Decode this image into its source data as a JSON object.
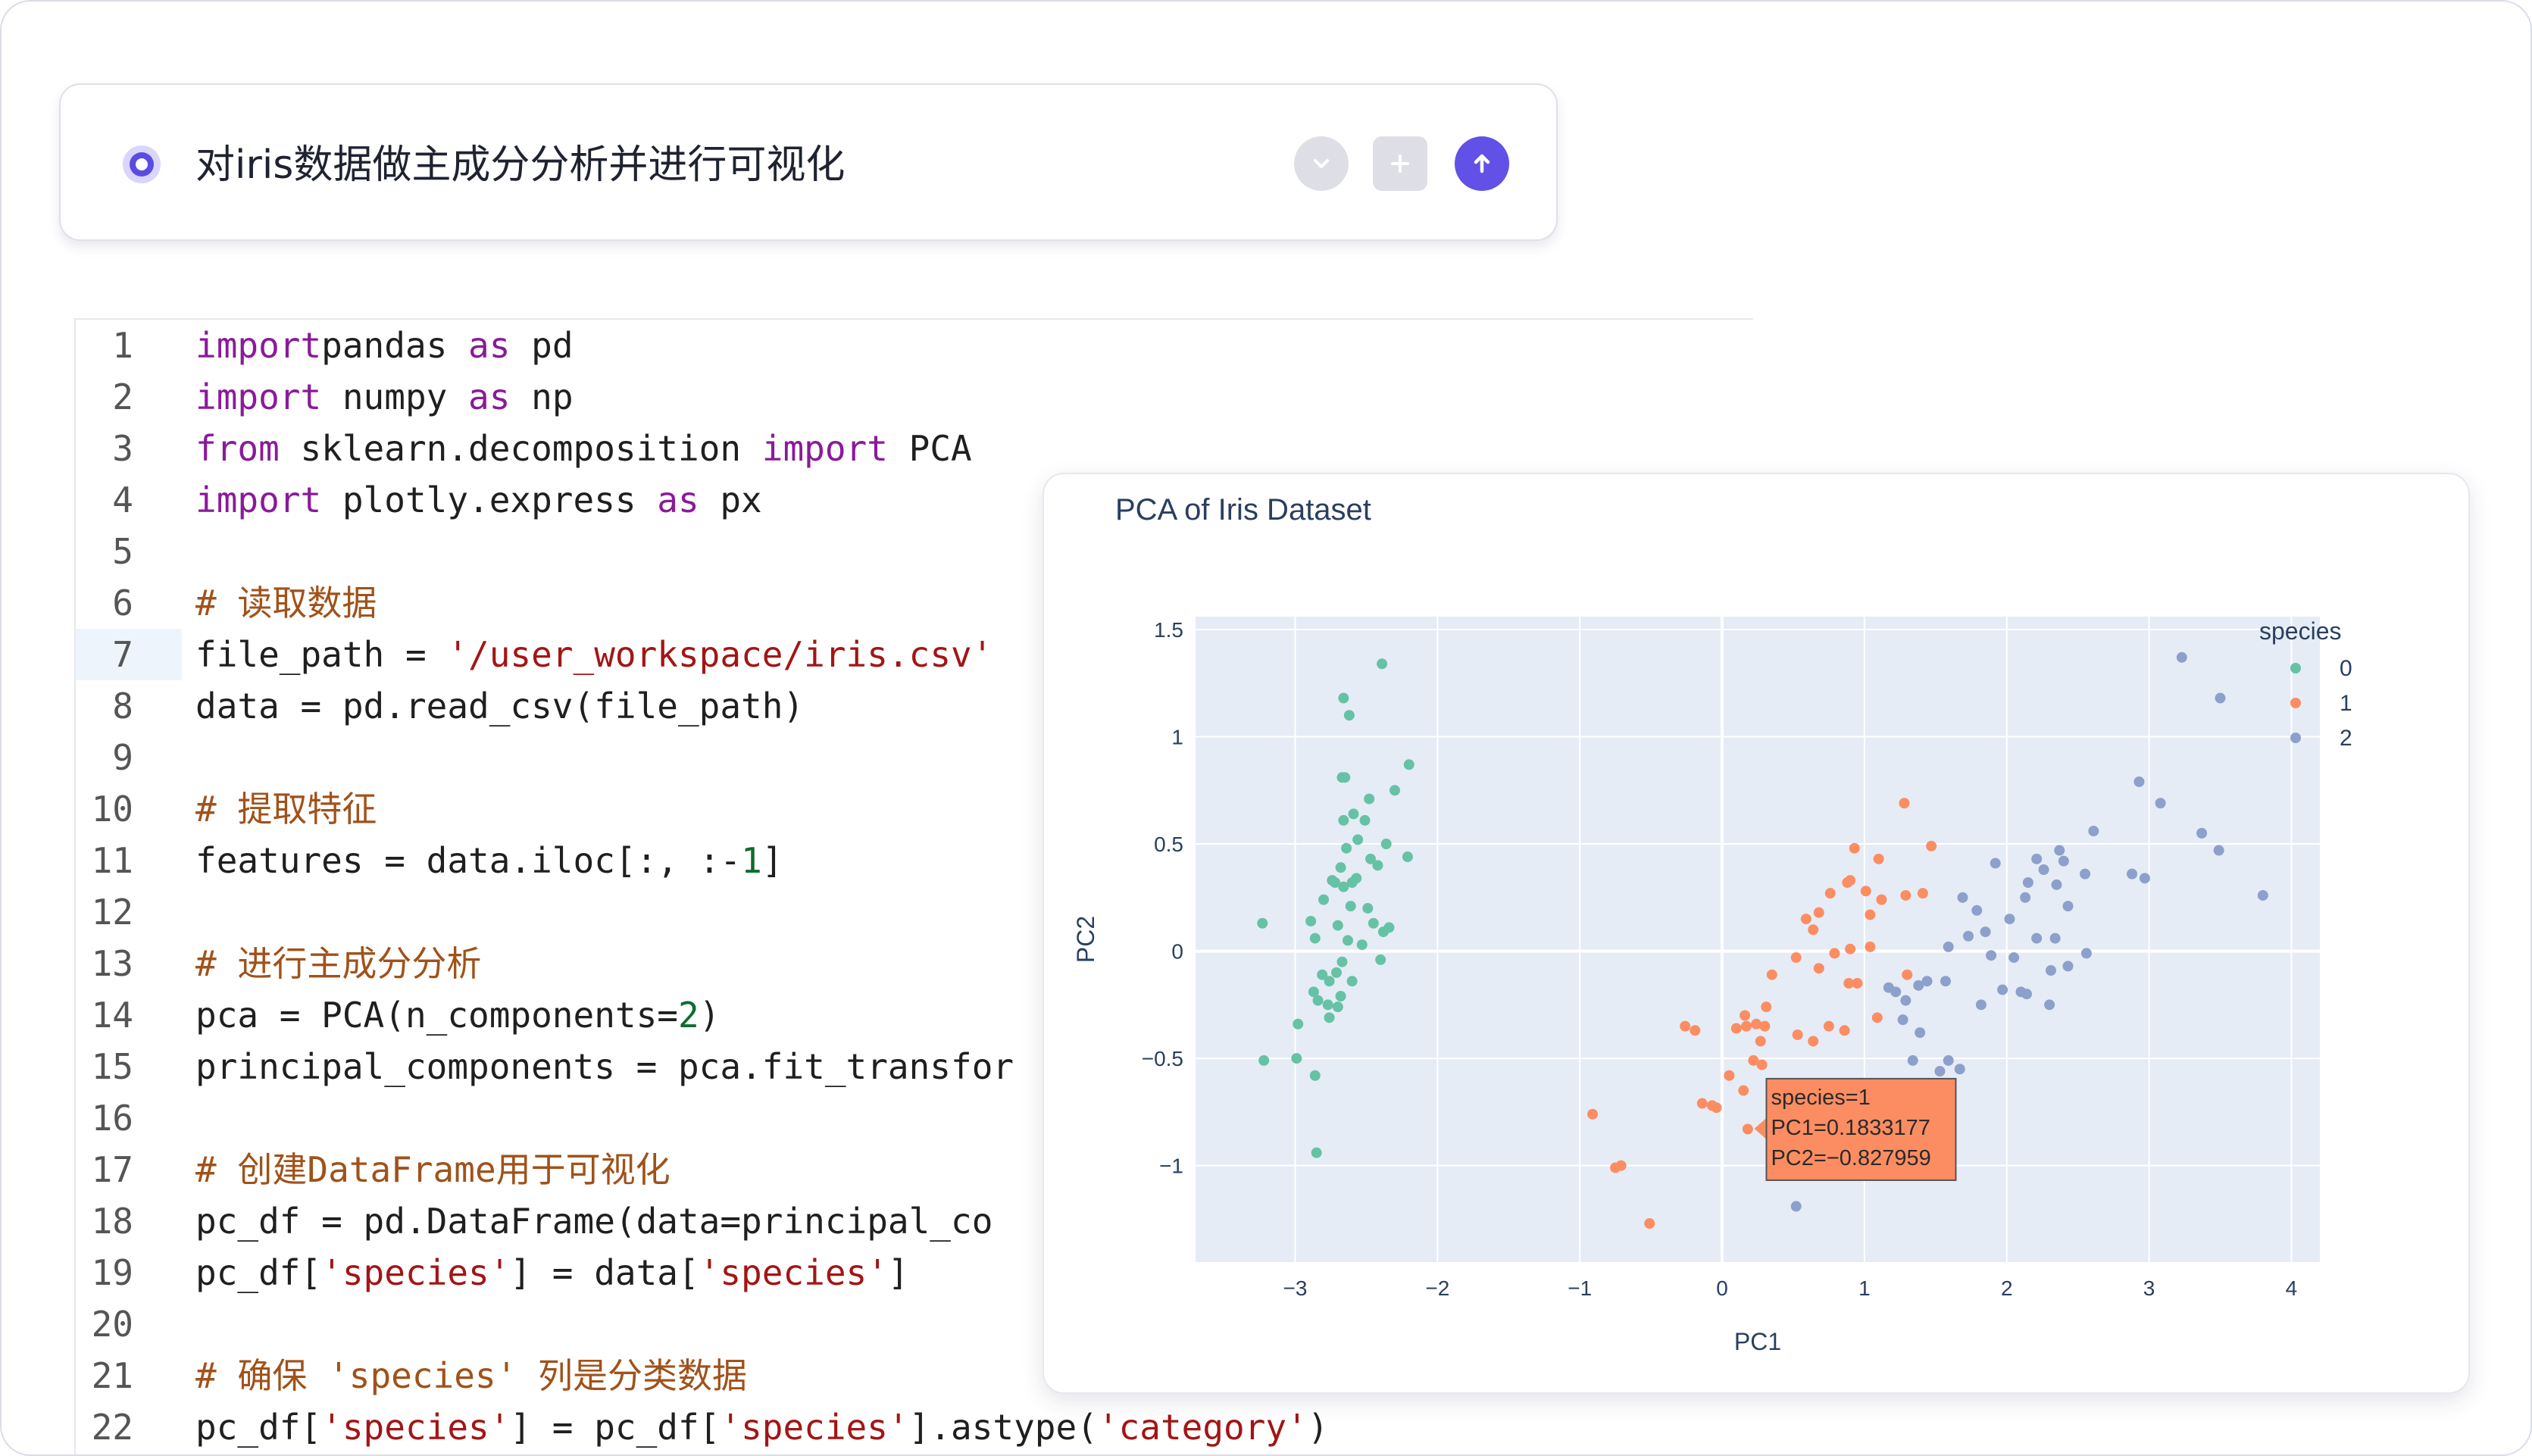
{
  "prompt": {
    "text": "对iris数据做主成分分析并进行可视化",
    "collapse_icon": "chevron-down-icon",
    "attach_icon": "plus-icon",
    "send_icon": "arrow-up-icon",
    "accent_color": "#6151e6"
  },
  "editor": {
    "active_line": 7,
    "lines": [
      {
        "n": "1",
        "segments": [
          [
            "kw",
            "import"
          ],
          [
            "",
            "pandas "
          ],
          [
            "kw",
            "as"
          ],
          [
            "",
            " pd"
          ]
        ]
      },
      {
        "n": "2",
        "segments": [
          [
            "kw",
            "import"
          ],
          [
            "",
            " numpy "
          ],
          [
            "kw",
            "as"
          ],
          [
            "",
            " np"
          ]
        ]
      },
      {
        "n": "3",
        "segments": [
          [
            "kw",
            "from"
          ],
          [
            "",
            " sklearn.decomposition "
          ],
          [
            "kw",
            "import"
          ],
          [
            "",
            " PCA"
          ]
        ]
      },
      {
        "n": "4",
        "segments": [
          [
            "kw",
            "import"
          ],
          [
            "",
            " plotly.express "
          ],
          [
            "kw",
            "as"
          ],
          [
            "",
            " px"
          ]
        ]
      },
      {
        "n": "5",
        "segments": []
      },
      {
        "n": "6",
        "segments": [
          [
            "cm",
            "# 读取数据"
          ]
        ]
      },
      {
        "n": "7",
        "segments": [
          [
            "",
            "file_path = "
          ],
          [
            "str",
            "'/user_workspace/iris.csv'"
          ]
        ]
      },
      {
        "n": "8",
        "segments": [
          [
            "",
            "data = pd.read_csv(file_path)"
          ]
        ]
      },
      {
        "n": "9",
        "segments": []
      },
      {
        "n": "10",
        "segments": [
          [
            "cm",
            "# 提取特征"
          ]
        ]
      },
      {
        "n": "11",
        "segments": [
          [
            "",
            "features = data.iloc[:, :-"
          ],
          [
            "num",
            "1"
          ],
          [
            "",
            "]"
          ]
        ]
      },
      {
        "n": "12",
        "segments": []
      },
      {
        "n": "13",
        "segments": [
          [
            "cm",
            "# 进行主成分分析"
          ]
        ]
      },
      {
        "n": "14",
        "segments": [
          [
            "",
            "pca = PCA(n_components="
          ],
          [
            "num",
            "2"
          ],
          [
            "",
            ")"
          ]
        ]
      },
      {
        "n": "15",
        "segments": [
          [
            "",
            "principal_components = pca.fit_transfor"
          ]
        ]
      },
      {
        "n": "16",
        "segments": []
      },
      {
        "n": "17",
        "segments": [
          [
            "cm",
            "# 创建DataFrame用于可视化"
          ]
        ]
      },
      {
        "n": "18",
        "segments": [
          [
            "",
            "pc_df = pd.DataFrame(data=principal_co"
          ]
        ]
      },
      {
        "n": "19",
        "segments": [
          [
            "",
            "pc_df["
          ],
          [
            "str",
            "'species'"
          ],
          [
            "",
            "] = data["
          ],
          [
            "str",
            "'species'"
          ],
          [
            "",
            "]"
          ]
        ]
      },
      {
        "n": "20",
        "segments": []
      },
      {
        "n": "21",
        "segments": [
          [
            "cm",
            "# 确保 'species' 列是分类数据"
          ]
        ]
      },
      {
        "n": "22",
        "segments": [
          [
            "",
            "pc_df["
          ],
          [
            "str",
            "'species'"
          ],
          [
            "",
            "] = pc_df["
          ],
          [
            "str",
            "'species'"
          ],
          [
            "",
            "].astype("
          ],
          [
            "str",
            "'category'"
          ],
          [
            "",
            ")"
          ]
        ]
      }
    ]
  },
  "chart_data": {
    "type": "scatter",
    "title": "PCA of Iris Dataset",
    "xlabel": "PC1",
    "ylabel": "PC2",
    "xlim": [
      -3.7,
      4.2
    ],
    "ylim": [
      -1.45,
      1.56
    ],
    "xticks": [
      -3,
      -2,
      -1,
      0,
      1,
      2,
      3,
      4
    ],
    "xtick_labels": [
      "−3",
      "−2",
      "−1",
      "0",
      "1",
      "2",
      "3",
      "4"
    ],
    "yticks": [
      -1,
      -0.5,
      0,
      0.5,
      1,
      1.5
    ],
    "ytick_labels": [
      "−1",
      "−0.5",
      "0",
      "0.5",
      "1",
      "1.5"
    ],
    "grid": true,
    "legend_title": "species",
    "legend_position": "top-right",
    "plot_bg": "#e5ecf6",
    "series": [
      {
        "name": "0",
        "color": "#66c2a5",
        "points": [
          [
            -2.39,
            1.34
          ],
          [
            -2.66,
            1.18
          ],
          [
            -2.62,
            1.1
          ],
          [
            -2.2,
            0.87
          ],
          [
            -2.3,
            0.75
          ],
          [
            -2.48,
            0.71
          ],
          [
            -2.65,
            0.81
          ],
          [
            -2.67,
            0.81
          ],
          [
            -2.59,
            0.64
          ],
          [
            -2.66,
            0.61
          ],
          [
            -2.51,
            0.61
          ],
          [
            -2.36,
            0.5
          ],
          [
            -2.56,
            0.52
          ],
          [
            -2.64,
            0.48
          ],
          [
            -2.68,
            0.39
          ],
          [
            -2.47,
            0.43
          ],
          [
            -2.21,
            0.44
          ],
          [
            -2.42,
            0.4
          ],
          [
            -2.57,
            0.34
          ],
          [
            -2.72,
            0.32
          ],
          [
            -2.74,
            0.33
          ],
          [
            -2.6,
            0.32
          ],
          [
            -2.66,
            0.3
          ],
          [
            -2.61,
            0.21
          ],
          [
            -2.8,
            0.24
          ],
          [
            -2.49,
            0.2
          ],
          [
            -2.34,
            0.11
          ],
          [
            -2.45,
            0.13
          ],
          [
            -2.7,
            0.12
          ],
          [
            -2.89,
            0.14
          ],
          [
            -3.23,
            0.13
          ],
          [
            -2.38,
            0.09
          ],
          [
            -2.63,
            0.05
          ],
          [
            -2.86,
            0.06
          ],
          [
            -2.53,
            0.03
          ],
          [
            -2.67,
            -0.05
          ],
          [
            -2.4,
            -0.04
          ],
          [
            -2.71,
            -0.1
          ],
          [
            -2.81,
            -0.11
          ],
          [
            -2.6,
            -0.14
          ],
          [
            -2.76,
            -0.14
          ],
          [
            -2.87,
            -0.19
          ],
          [
            -2.68,
            -0.21
          ],
          [
            -2.84,
            -0.23
          ],
          [
            -2.77,
            -0.25
          ],
          [
            -2.7,
            -0.26
          ],
          [
            -2.76,
            -0.31
          ],
          [
            -2.98,
            -0.34
          ],
          [
            -3.22,
            -0.51
          ],
          [
            -2.99,
            -0.5
          ],
          [
            -2.86,
            -0.58
          ],
          [
            -2.85,
            -0.94
          ]
        ]
      },
      {
        "name": "1",
        "color": "#fc8d62",
        "points": [
          [
            1.28,
            0.69
          ],
          [
            1.47,
            0.49
          ],
          [
            0.93,
            0.48
          ],
          [
            1.1,
            0.43
          ],
          [
            0.9,
            0.33
          ],
          [
            0.88,
            0.32
          ],
          [
            1.01,
            0.28
          ],
          [
            1.41,
            0.27
          ],
          [
            1.29,
            0.26
          ],
          [
            0.76,
            0.27
          ],
          [
            1.12,
            0.24
          ],
          [
            0.68,
            0.18
          ],
          [
            0.59,
            0.15
          ],
          [
            1.04,
            0.17
          ],
          [
            0.64,
            0.1
          ],
          [
            0.52,
            -0.03
          ],
          [
            0.9,
            0.01
          ],
          [
            0.79,
            -0.01
          ],
          [
            1.04,
            0.02
          ],
          [
            0.35,
            -0.11
          ],
          [
            0.68,
            -0.08
          ],
          [
            1.3,
            -0.11
          ],
          [
            0.89,
            -0.15
          ],
          [
            0.95,
            -0.15
          ],
          [
            0.16,
            -0.3
          ],
          [
            0.31,
            -0.26
          ],
          [
            0.24,
            -0.34
          ],
          [
            0.53,
            -0.39
          ],
          [
            0.27,
            -0.42
          ],
          [
            0.17,
            -0.35
          ],
          [
            0.3,
            -0.35
          ],
          [
            0.1,
            -0.36
          ],
          [
            0.75,
            -0.35
          ],
          [
            -0.19,
            -0.37
          ],
          [
            0.64,
            -0.42
          ],
          [
            0.86,
            -0.37
          ],
          [
            0.22,
            -0.51
          ],
          [
            0.28,
            -0.53
          ],
          [
            1.09,
            -0.31
          ],
          [
            -0.26,
            -0.35
          ],
          [
            0.35,
            -0.66
          ],
          [
            0.05,
            -0.58
          ],
          [
            0.15,
            -0.65
          ],
          [
            -0.14,
            -0.71
          ],
          [
            -0.04,
            -0.73
          ],
          [
            -0.07,
            -0.72
          ],
          [
            0.18,
            -0.83
          ],
          [
            -0.91,
            -0.76
          ],
          [
            -0.75,
            -1.01
          ],
          [
            -0.71,
            -1.0
          ],
          [
            -0.51,
            -1.27
          ]
        ]
      },
      {
        "name": "2",
        "color": "#8da0cb",
        "points": [
          [
            3.23,
            1.37
          ],
          [
            3.5,
            1.18
          ],
          [
            2.93,
            0.79
          ],
          [
            3.08,
            0.69
          ],
          [
            3.37,
            0.55
          ],
          [
            3.49,
            0.47
          ],
          [
            2.61,
            0.56
          ],
          [
            2.37,
            0.47
          ],
          [
            2.88,
            0.36
          ],
          [
            2.97,
            0.34
          ],
          [
            3.8,
            0.26
          ],
          [
            2.21,
            0.43
          ],
          [
            2.4,
            0.42
          ],
          [
            1.92,
            0.41
          ],
          [
            2.15,
            0.32
          ],
          [
            2.26,
            0.38
          ],
          [
            2.35,
            0.31
          ],
          [
            2.55,
            0.36
          ],
          [
            2.43,
            0.21
          ],
          [
            2.13,
            0.25
          ],
          [
            1.69,
            0.25
          ],
          [
            1.79,
            0.19
          ],
          [
            2.02,
            0.15
          ],
          [
            1.85,
            0.09
          ],
          [
            2.21,
            0.06
          ],
          [
            2.34,
            0.06
          ],
          [
            1.89,
            -0.02
          ],
          [
            1.73,
            0.07
          ],
          [
            1.59,
            0.02
          ],
          [
            2.05,
            -0.03
          ],
          [
            2.56,
            -0.01
          ],
          [
            2.31,
            -0.09
          ],
          [
            2.43,
            -0.07
          ],
          [
            1.17,
            -0.17
          ],
          [
            1.22,
            -0.19
          ],
          [
            1.38,
            -0.16
          ],
          [
            1.29,
            -0.23
          ],
          [
            1.44,
            -0.14
          ],
          [
            1.57,
            -0.14
          ],
          [
            1.82,
            -0.25
          ],
          [
            1.97,
            -0.18
          ],
          [
            2.1,
            -0.19
          ],
          [
            2.14,
            -0.2
          ],
          [
            2.3,
            -0.25
          ],
          [
            1.27,
            -0.32
          ],
          [
            1.39,
            -0.38
          ],
          [
            1.34,
            -0.51
          ],
          [
            1.59,
            -0.51
          ],
          [
            1.53,
            -0.56
          ],
          [
            1.67,
            -0.55
          ],
          [
            1.2,
            -0.62
          ],
          [
            0.52,
            -1.19
          ]
        ]
      }
    ],
    "hover": {
      "series": "1",
      "point": [
        0.1833177,
        -0.827959
      ],
      "lines": [
        "species=1",
        "PC1=0.1833177",
        "PC2=−0.827959"
      ]
    }
  }
}
